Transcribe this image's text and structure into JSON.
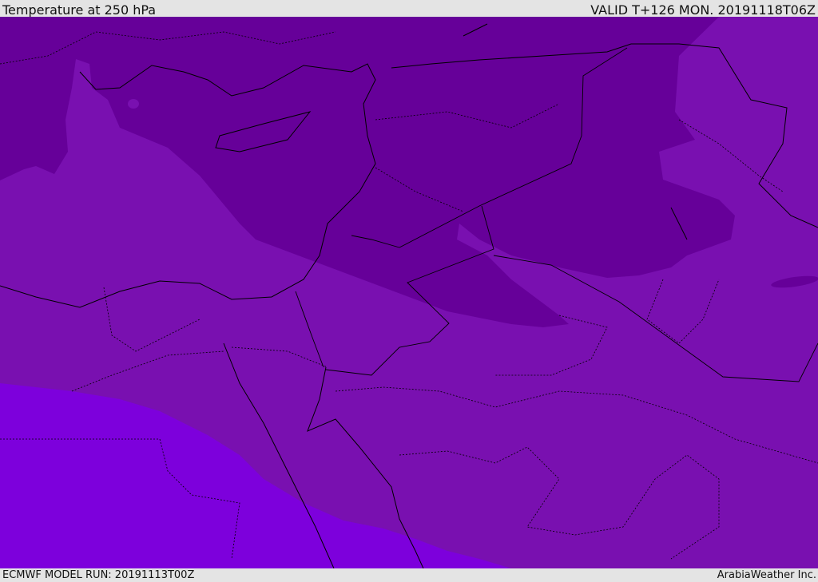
{
  "header": {
    "title": "Temperature at 250 hPa",
    "valid": "VALID T+126 MON. 20191118T06Z"
  },
  "footer": {
    "model_run": "ECMWF MODEL RUN: 20191113T00Z",
    "brand": "ArabiaWeather Inc."
  },
  "colors": {
    "dark_band": "#660099",
    "mid_band": "#7910b0",
    "bright_band": "#7d00dc",
    "background": "#e4e4e4"
  }
}
